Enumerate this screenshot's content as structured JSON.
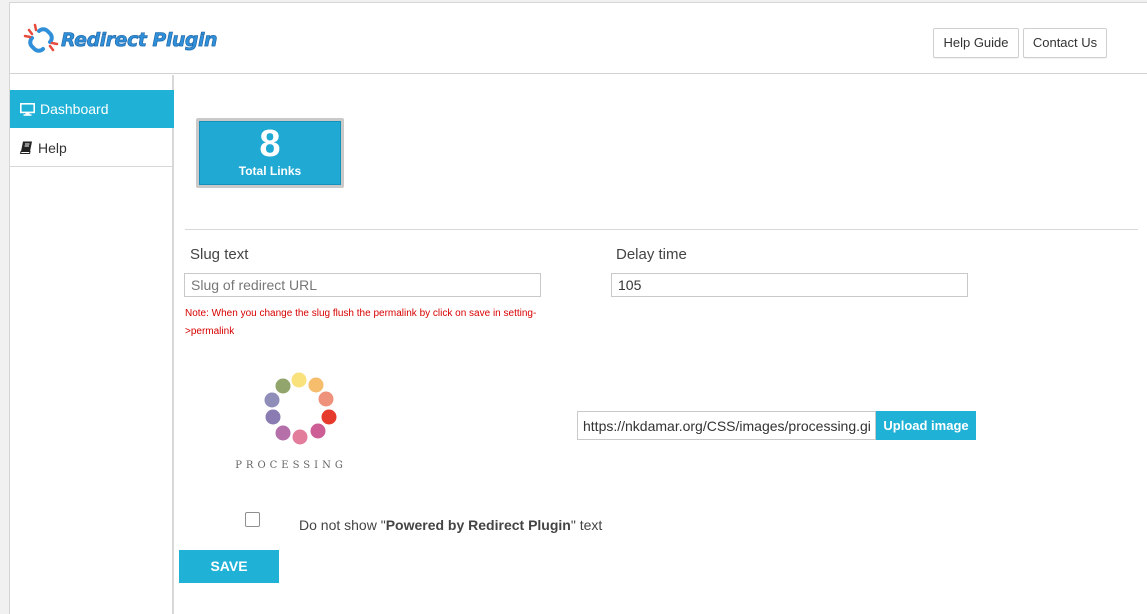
{
  "app": {
    "logo_text": "Redirect Plugin",
    "brand_color": "#2f8fd8",
    "accent_color": "#1fb1d6"
  },
  "header": {
    "help_guide_label": "Help Guide",
    "contact_us_label": "Contact Us"
  },
  "sidebar": {
    "items": [
      {
        "label": "Dashboard",
        "icon": "monitor-icon",
        "active": true
      },
      {
        "label": "Help",
        "icon": "book-icon",
        "active": false
      }
    ]
  },
  "stats": {
    "total_links_value": "8",
    "total_links_label": "Total Links"
  },
  "form": {
    "slug_label": "Slug text",
    "slug_placeholder": "Slug of redirect URL",
    "slug_value": "",
    "delay_label": "Delay time",
    "delay_value": "105",
    "note": "Note: When you change the slug flush the permalink by click on save in setting->permalink",
    "image_url_value": "https://nkdamar.org/CSS/images/processing.gif",
    "upload_button_label": "Upload image",
    "processing_caption": "PROCESSING",
    "powered_prefix": "Do not show \"",
    "powered_bold": "Powered by Redirect Plugin",
    "powered_suffix": "\" text",
    "hide_powered_checked": false,
    "save_button_label": "SAVE",
    "note_color": "#d80000"
  }
}
